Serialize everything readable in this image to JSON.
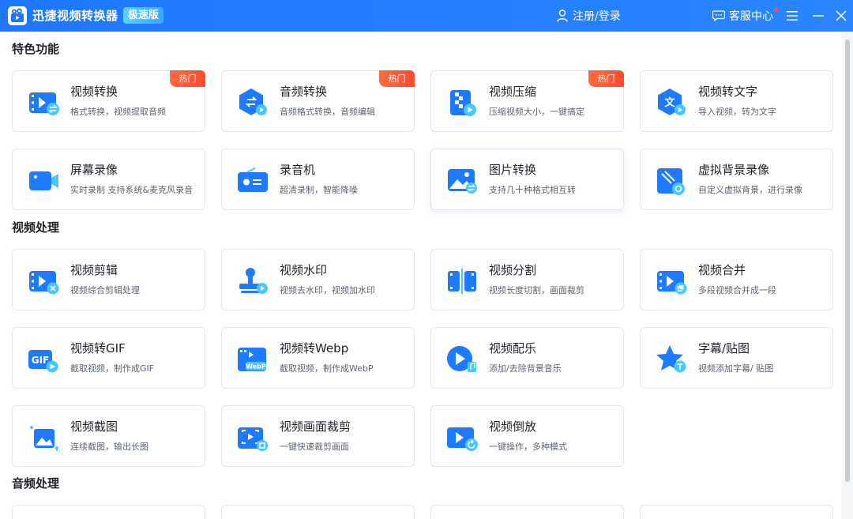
{
  "titlebar": {
    "app_name": "迅捷视频转换器",
    "edition": "极速版",
    "login": "注册/登录",
    "service": "客服中心"
  },
  "colors": {
    "titlebar": "#1e78ff",
    "hot_badge": "#ff4a2e",
    "icon_primary": "#1e7bff",
    "icon_secondary": "#49c6ff"
  },
  "sections": [
    {
      "title": "特色功能",
      "cards": [
        {
          "icon": "video-convert-icon",
          "title": "视频转换",
          "desc": "格式转换，视频提取音频",
          "badge": "热门"
        },
        {
          "icon": "audio-convert-icon",
          "title": "音频转换",
          "desc": "音频格式转换，音频编辑",
          "badge": "热门"
        },
        {
          "icon": "video-compress-icon",
          "title": "视频压缩",
          "desc": "压缩视频大小，一键搞定",
          "badge": "热门"
        },
        {
          "icon": "video-to-text-icon",
          "title": "视频转文字",
          "desc": "导入视频，转为文字"
        },
        {
          "icon": "screen-record-icon",
          "title": "屏幕录像",
          "desc": "实时录制 支持系统&麦克风录音"
        },
        {
          "icon": "recorder-icon",
          "title": "录音机",
          "desc": "超清录制，智能降噪"
        },
        {
          "icon": "image-convert-icon",
          "title": "图片转换",
          "desc": "支持几十种格式相互转"
        },
        {
          "icon": "virtual-background-icon",
          "title": "虚拟背景录像",
          "desc": "自定义虚拟背景，进行录像"
        }
      ]
    },
    {
      "title": "视频处理",
      "cards": [
        {
          "icon": "video-edit-icon",
          "title": "视频剪辑",
          "desc": "视频综合剪辑处理"
        },
        {
          "icon": "watermark-icon",
          "title": "视频水印",
          "desc": "视频去水印，视频加水印"
        },
        {
          "icon": "video-split-icon",
          "title": "视频分割",
          "desc": "视频长度切割，画面裁剪"
        },
        {
          "icon": "video-merge-icon",
          "title": "视频合并",
          "desc": "多段视频合并成一段"
        },
        {
          "icon": "gif-icon",
          "title": "视频转GIF",
          "desc": "截取视频，制作成GIF"
        },
        {
          "icon": "webp-icon",
          "title": "视频转Webp",
          "desc": "截取视频，制作成WebP"
        },
        {
          "icon": "music-icon",
          "title": "视频配乐",
          "desc": "添加/去除背景音乐"
        },
        {
          "icon": "subtitle-sticker-icon",
          "title": "字幕/贴图",
          "desc": "视频添加字幕/ 贴图"
        },
        {
          "icon": "screenshot-icon",
          "title": "视频截图",
          "desc": "连续截图，输出长图"
        },
        {
          "icon": "crop-icon",
          "title": "视频画面裁剪",
          "desc": "一键快速裁剪画面"
        },
        {
          "icon": "reverse-icon",
          "title": "视频倒放",
          "desc": "一键操作，多种模式"
        }
      ]
    },
    {
      "title": "音频处理",
      "cards": []
    }
  ]
}
